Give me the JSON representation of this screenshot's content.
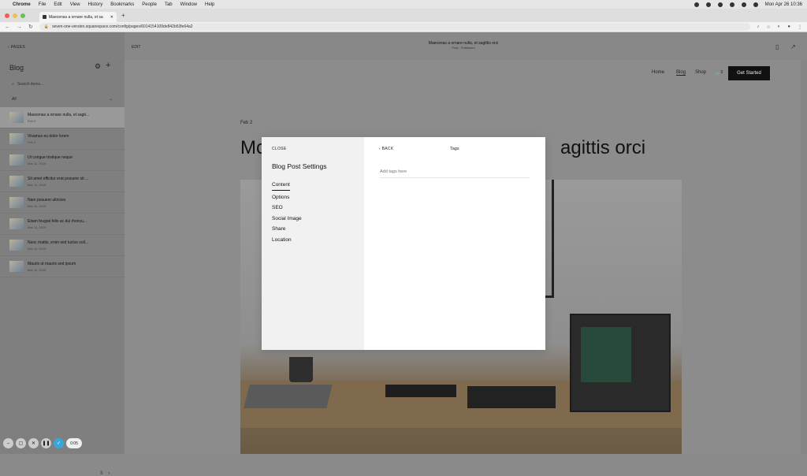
{
  "menubar": {
    "app": "Chrome",
    "items": [
      "File",
      "Edit",
      "View",
      "History",
      "Bookmarks",
      "People",
      "Tab",
      "Window",
      "Help"
    ],
    "datetime": "Mon Apr 26  10:36"
  },
  "browser": {
    "tab_title": "Maecenas a ornare nulla, et sa",
    "url": "seven-one-version.squarespace.com/config/pages/6014154109de842b53fe64a2"
  },
  "sidebar": {
    "back_label": "PAGES",
    "title": "Blog",
    "search_placeholder": "Search items...",
    "filter": "All",
    "posts": [
      {
        "title": "Maecenas a ornare nulla, et sagit...",
        "date": "Feb 2"
      },
      {
        "title": "Vivamus eu dolor lorem",
        "date": "Feb 2"
      },
      {
        "title": "Ut congue tristique neque",
        "date": "Mar 11, 2019"
      },
      {
        "title": "Sit amet efficitur erat posuere sit ...",
        "date": "Mar 11, 2019"
      },
      {
        "title": "Nam posuere ultricies",
        "date": "Mar 11, 2019"
      },
      {
        "title": "Etiam feugiat felis ac dui rhoncu...",
        "date": "Mar 11, 2019"
      },
      {
        "title": "Nunc mattis, enim sed luctus soll...",
        "date": "Mar 11, 2019"
      },
      {
        "title": "Mauris ut mauris sed ipsum",
        "date": "Mar 11, 2019"
      }
    ],
    "page_num": "3",
    "next_glyph": "›"
  },
  "recorder": {
    "time": "0:05"
  },
  "editbar": {
    "edit_label": "EDIT",
    "page_title": "Maecenas a ornare nulla, et sagittis orci",
    "page_status": "Post · Published"
  },
  "site": {
    "nav": {
      "home": "Home",
      "blog": "Blog",
      "shop": "Shop",
      "cart_count": "0"
    },
    "cta": "Get Started",
    "post_date": "Feb 2",
    "post_title_left": "Mc",
    "post_title_right": "agittis orci"
  },
  "modal": {
    "close_label": "CLOSE",
    "title": "Blog Post Settings",
    "menu": [
      "Content",
      "Options",
      "SEO",
      "Social Image",
      "Share",
      "Location"
    ],
    "selected": "Content",
    "back_label": "BACK",
    "panel_title": "Tags",
    "tag_placeholder": "Add tags here"
  }
}
